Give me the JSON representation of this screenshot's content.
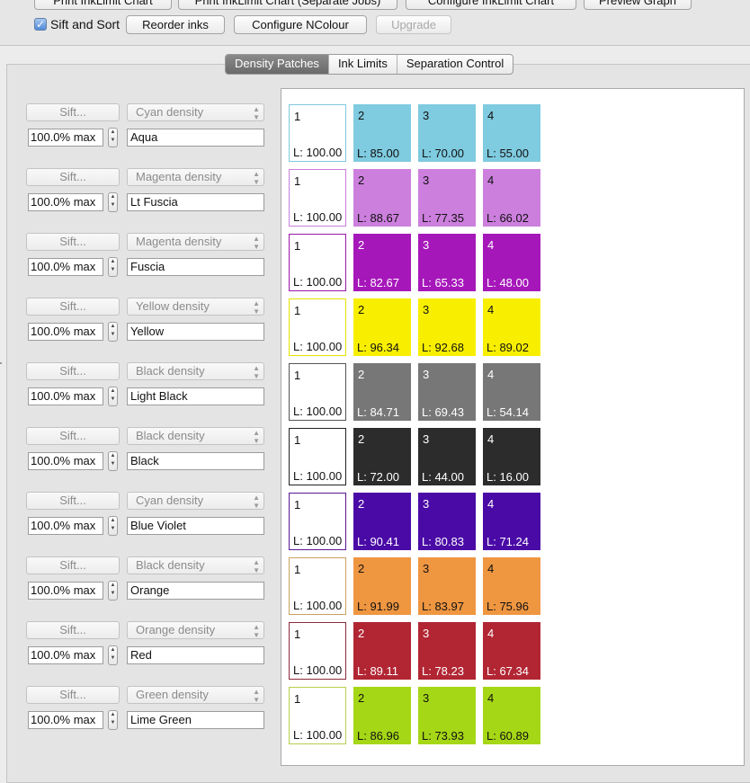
{
  "toolbar": {
    "top_buttons": [
      "Print InkLimit Chart",
      "Print InkLimit Chart (Separate Jobs)",
      "Configure InkLimit Chart",
      "Preview Graph"
    ],
    "sift_sort_label": "Sift and Sort",
    "sift_sort_checked": true,
    "reorder_label": "Reorder inks",
    "configure_label": "Configure NColour",
    "upgrade_label": "Upgrade"
  },
  "tabs": [
    {
      "label": "Density Patches",
      "active": true
    },
    {
      "label": "Ink Limits",
      "active": false
    },
    {
      "label": "Separation Control",
      "active": false
    }
  ],
  "inks": [
    {
      "sift": "Sift...",
      "density": "Cyan density",
      "max": "100.0% max",
      "name": "Aqua",
      "border": "#7fc9df",
      "color": "#7fcbe0",
      "text": "#111111",
      "patches": [
        {
          "num": "1",
          "l": "L: 100.00"
        },
        {
          "num": "2",
          "l": "L: 85.00"
        },
        {
          "num": "3",
          "l": "L: 70.00"
        },
        {
          "num": "4",
          "l": "L: 55.00"
        }
      ]
    },
    {
      "sift": "Sift...",
      "density": "Magenta density",
      "max": "100.0% max",
      "name": "Lt Fuscia",
      "border": "#c97ed9",
      "color": "#cc7fdd",
      "text": "#111111",
      "patches": [
        {
          "num": "1",
          "l": "L: 100.00"
        },
        {
          "num": "2",
          "l": "L: 88.67"
        },
        {
          "num": "3",
          "l": "L: 77.35"
        },
        {
          "num": "4",
          "l": "L: 66.02"
        }
      ]
    },
    {
      "sift": "Sift...",
      "density": "Magenta density",
      "max": "100.0% max",
      "name": "Fuscia",
      "border": "#9a17a7",
      "color": "#a617ba",
      "text": "#ffffff",
      "patches": [
        {
          "num": "1",
          "l": "L: 100.00"
        },
        {
          "num": "2",
          "l": "L: 82.67"
        },
        {
          "num": "3",
          "l": "L: 65.33"
        },
        {
          "num": "4",
          "l": "L: 48.00"
        }
      ]
    },
    {
      "sift": "Sift...",
      "density": "Yellow density",
      "max": "100.0% max",
      "name": "Yellow",
      "border": "#e6e200",
      "color": "#f8ef00",
      "text": "#111111",
      "patches": [
        {
          "num": "1",
          "l": "L: 100.00"
        },
        {
          "num": "2",
          "l": "L: 96.34"
        },
        {
          "num": "3",
          "l": "L: 92.68"
        },
        {
          "num": "4",
          "l": "L: 89.02"
        }
      ]
    },
    {
      "sift": "Sift...",
      "density": "Black density",
      "max": "100.0% max",
      "name": "Light Black",
      "border": "#555555",
      "color": "#777777",
      "text": "#ffffff",
      "patches": [
        {
          "num": "1",
          "l": "L: 100.00"
        },
        {
          "num": "2",
          "l": "L: 84.71"
        },
        {
          "num": "3",
          "l": "L: 69.43"
        },
        {
          "num": "4",
          "l": "L: 54.14"
        }
      ]
    },
    {
      "sift": "Sift...",
      "density": "Black density",
      "max": "100.0% max",
      "name": "Black",
      "border": "#222222",
      "color": "#2c2c2c",
      "text": "#ffffff",
      "patches": [
        {
          "num": "1",
          "l": "L: 100.00"
        },
        {
          "num": "2",
          "l": "L: 72.00"
        },
        {
          "num": "3",
          "l": "L: 44.00"
        },
        {
          "num": "4",
          "l": "L: 16.00"
        }
      ]
    },
    {
      "sift": "Sift...",
      "density": "Cyan density",
      "max": "100.0% max",
      "name": "Blue Violet",
      "border": "#5c1593",
      "color": "#4a0aa6",
      "text": "#ffffff",
      "patches": [
        {
          "num": "1",
          "l": "L: 100.00"
        },
        {
          "num": "2",
          "l": "L: 90.41"
        },
        {
          "num": "3",
          "l": "L: 80.83"
        },
        {
          "num": "4",
          "l": "L: 71.24"
        }
      ]
    },
    {
      "sift": "Sift...",
      "density": "Black density",
      "max": "100.0% max",
      "name": "Orange",
      "border": "#c9a25c",
      "color": "#ef9641",
      "text": "#111111",
      "patches": [
        {
          "num": "1",
          "l": "L: 100.00"
        },
        {
          "num": "2",
          "l": "L: 91.99"
        },
        {
          "num": "3",
          "l": "L: 83.97"
        },
        {
          "num": "4",
          "l": "L: 75.96"
        }
      ]
    },
    {
      "sift": "Sift...",
      "density": "Orange density",
      "max": "100.0% max",
      "name": "Red",
      "border": "#8a2a3a",
      "color": "#b22634",
      "text": "#ffffff",
      "patches": [
        {
          "num": "1",
          "l": "L: 100.00"
        },
        {
          "num": "2",
          "l": "L: 89.11"
        },
        {
          "num": "3",
          "l": "L: 78.23"
        },
        {
          "num": "4",
          "l": "L: 67.34"
        }
      ]
    },
    {
      "sift": "Sift...",
      "density": "Green density",
      "max": "100.0% max",
      "name": "Lime Green",
      "border": "#b5cf4d",
      "color": "#a6d716",
      "text": "#111111",
      "patches": [
        {
          "num": "1",
          "l": "L: 100.00"
        },
        {
          "num": "2",
          "l": "L: 86.96"
        },
        {
          "num": "3",
          "l": "L: 73.93"
        },
        {
          "num": "4",
          "l": "L: 60.89"
        }
      ]
    }
  ]
}
